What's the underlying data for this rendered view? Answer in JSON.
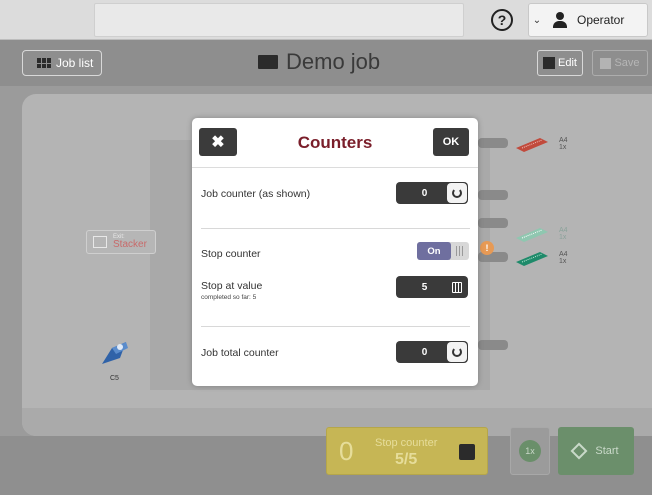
{
  "topbar": {
    "help_icon": "question-circle-icon",
    "operator_label": "Operator"
  },
  "job_header": {
    "job_list_label": "Job list",
    "title": "Demo job",
    "edit_label": "Edit",
    "save_label": "Save"
  },
  "machine": {
    "exit_small": "Exit:",
    "exit_value": "Stacker",
    "envelope_label": "C5",
    "trays": [
      {
        "size": "A4",
        "qty": "1x",
        "color": "#c14a3c"
      },
      {
        "size": "A4",
        "qty": "1x",
        "color": "#8fc7b0"
      },
      {
        "size": "A4",
        "qty": "1x",
        "color": "#1e8a6a"
      }
    ]
  },
  "dialog": {
    "title": "Counters",
    "close_icon": "close-icon",
    "ok_label": "OK",
    "job_counter_label": "Job counter (as shown)",
    "job_counter_value": "0",
    "stop_counter_label": "Stop counter",
    "stop_counter_state": "On",
    "stop_at_label": "Stop at value",
    "stop_at_sub": "completed so far: 5",
    "stop_at_value": "5",
    "job_total_label": "Job total counter",
    "job_total_value": "0"
  },
  "bottom": {
    "count_value": "0",
    "stop_counter_label": "Stop counter",
    "stop_counter_value": "5/5",
    "multiplier": "1x",
    "start_label": "Start"
  }
}
